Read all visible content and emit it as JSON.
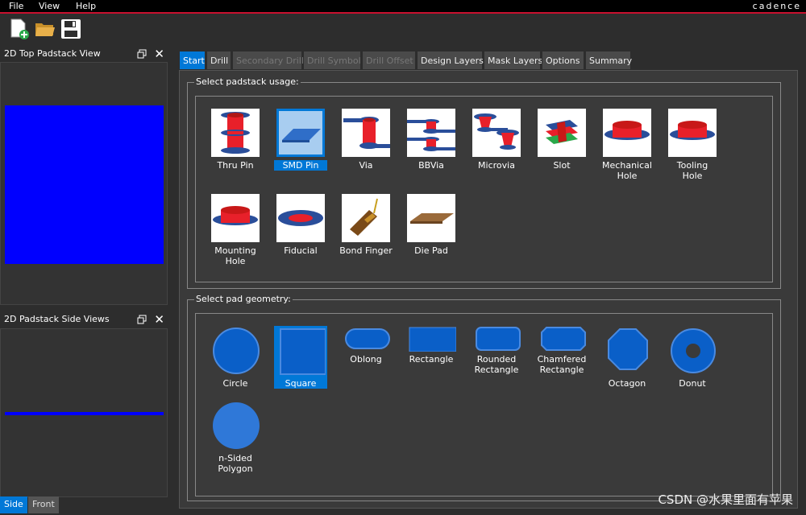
{
  "menu": {
    "file": "File",
    "view": "View",
    "help": "Help"
  },
  "brand": "cadence",
  "toolbar": {
    "new_icon": "new-document-icon",
    "open_icon": "folder-open-icon",
    "save_icon": "save-disk-icon"
  },
  "left": {
    "top_view_title": "2D Top Padstack View",
    "side_view_title": "2D Padstack Side Views",
    "tabs": [
      "Side",
      "Front"
    ]
  },
  "tabs": [
    "Start",
    "Drill",
    "Secondary Drill",
    "Drill Symbol",
    "Drill Offset",
    "Design Layers",
    "Mask Layers",
    "Options",
    "Summary"
  ],
  "usage": {
    "label": "Select padstack usage:",
    "items": [
      "Thru Pin",
      "SMD Pin",
      "Via",
      "BBVia",
      "Microvia",
      "Slot",
      "Mechanical Hole",
      "Tooling Hole",
      "Mounting Hole",
      "Fiducial",
      "Bond Finger",
      "Die Pad"
    ],
    "selected": "SMD Pin"
  },
  "geometry": {
    "label": "Select pad geometry:",
    "items": [
      "Circle",
      "Square",
      "Oblong",
      "Rectangle",
      "Rounded Rectangle",
      "Chamfered Rectangle",
      "Octagon",
      "Donut",
      "n-Sided Polygon"
    ],
    "selected": "Square"
  },
  "watermark": "CSDN @水果里面有苹果",
  "colors": {
    "accent": "#0078d7",
    "pad_blue": "#0000ff",
    "shape_blue": "#0a5fc8",
    "drill_red": "#e8202a",
    "brand_red": "#c8102e"
  }
}
